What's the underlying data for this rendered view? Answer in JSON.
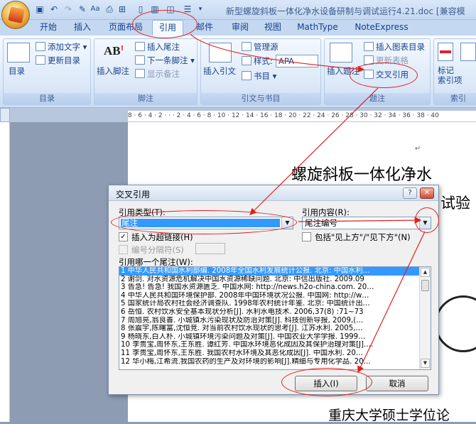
{
  "window": {
    "title": "新型螺旋斜板一体化净水设备研制与调试运行4.21.doc [兼容模"
  },
  "tabs": [
    "开始",
    "插入",
    "页面布局",
    "引用",
    "邮件",
    "审阅",
    "视图",
    "MathType",
    "NoteExpress"
  ],
  "ribbon": {
    "groups": {
      "toc": {
        "label": "目录",
        "big_button": "目录",
        "add_text": "添加文字",
        "update_toc": "更新目录"
      },
      "footnotes": {
        "label": "脚注",
        "insert_footnote": "插入脚注",
        "insert_endnote": "插入尾注",
        "next_footnote": "下一条脚注",
        "show_notes": "显示备注"
      },
      "citations": {
        "label": "引文与书目",
        "insert_citation": "插入引文",
        "manage_sources": "管理源",
        "style_label": "样式:",
        "style_value": "APA",
        "bibliography": "书目"
      },
      "captions": {
        "label": "题注",
        "insert_caption": "插入题注",
        "insert_table_of_figures": "插入图表目录",
        "update_table": "更新表格",
        "cross_reference": "交叉引用"
      },
      "index": {
        "label": "索引",
        "mark_entry": "标记\n索引项"
      }
    }
  },
  "ruler": {
    "text": "8 · 6 · 4 · 2 · · · 2 · 4 · 6 · 8 · 10 · 12 · 14 · 16 · 18 · 20 · 22 · 24 · 26 · 28 · 30 · 32 · 34 · 36 · 38 · 40"
  },
  "document": {
    "heading": "螺旋斜板一体化净水",
    "subheading": "试验",
    "footer": "重庆大学硕士学位论"
  },
  "dialog": {
    "title": "交叉引用",
    "ref_type_label": "引用类型(T):",
    "ref_type_value": "尾注",
    "ref_content_label": "引用内容(R):",
    "ref_content_value": "尾注编号",
    "insert_hyperlink_label": "插入为超链接(H)",
    "insert_hyperlink_checked": true,
    "above_below_label": "包括\"见上方\"/\"见下方\"(N)",
    "above_below_checked": false,
    "separator_label": "编号分隔符(S)",
    "list_label": "引用哪一个尾注(W):",
    "endnotes": [
      "1  中华人民共和国水利部编. 2008年全国水利发展统计公报. 北京: 中国水利…",
      "2  谢剑. 对水资源危机解决中国水资源稀缺问题. 北京: 中信出版社. 2009.09",
      "3  告急! 告急! 我国水资源匮乏. 中国水网: http://news.h2o-china.com. 20…",
      "4  中华人民共和国环境保护部. 2008年中国环境状况公报. 中国网: http://w…",
      "5  国家统计局农村社会经济调查队. 1998年农村统计年鉴. 北京: 中国统计出…",
      "6  岳恒. 农村饮水安全基本现状分析[J]. 水利水电技术. 2006,37(8) :71~73",
      "7  周旭亮,翁良善. 小城镇水污染现状及防治对策[J]. 科技创新导报, 2009,(…",
      "8  张震宇,陈曙富,沈恒竞. 对当前农村饮水现状的思考[J]. 江苏水利. 2005,…",
      "9  杨晓东,白人朴. 小城镇环境污染问题及对策[J]. 中国农业大学学报. 1999…",
      "10  李贵宝,周怀东,王东胜. 谭红芳. 中国水环境恶化成因及其保护治理对策[J].…",
      "11  李贵宝,周怀东,王东胜. 我国农村水环境及其恶化成因[J]. 中国水利. 20…",
      "12  华小梅,江希流.我国农药的生产及对环境的影响[J].精细与专用化学品. 20…"
    ],
    "selected_index": 0,
    "insert_button": "插入(I)",
    "cancel_button": "取消"
  },
  "colors": {
    "annotation": "#e02020",
    "selection": "#3399ff"
  }
}
